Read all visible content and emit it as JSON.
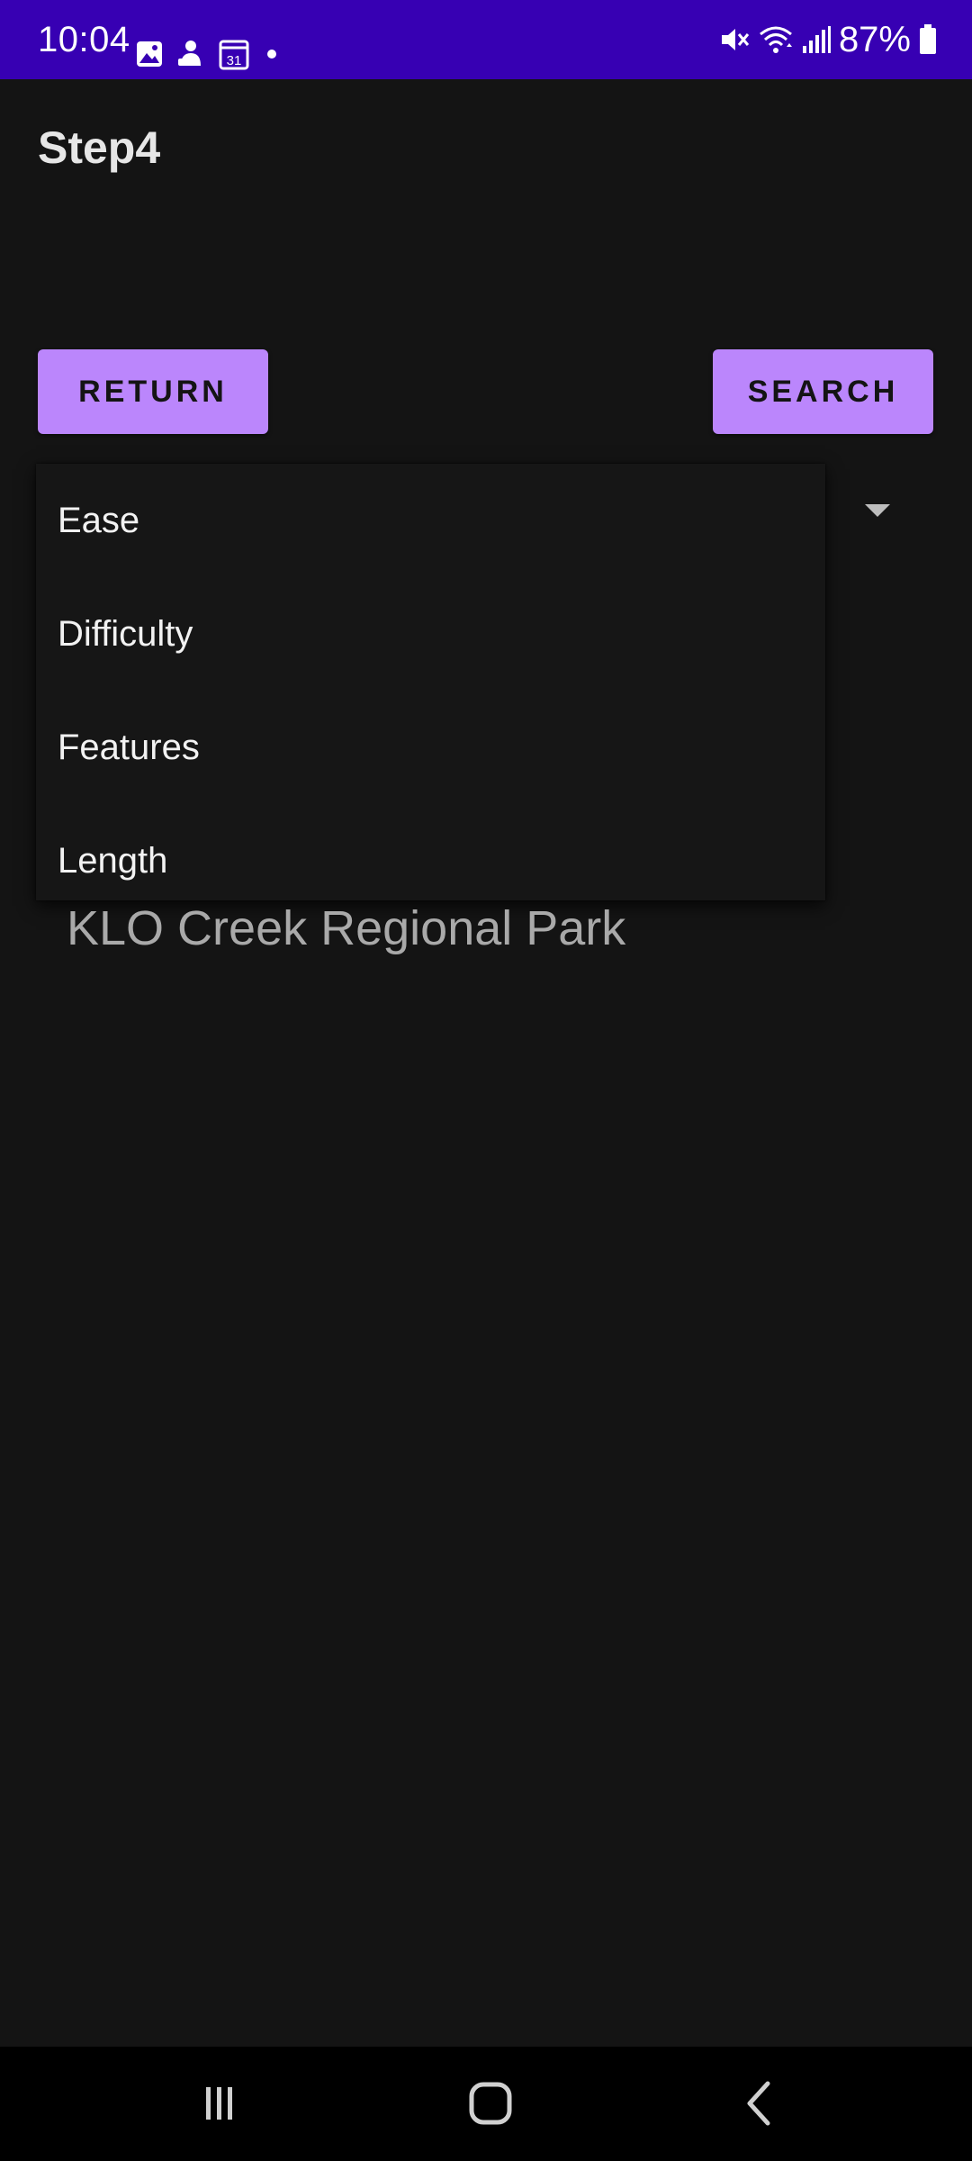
{
  "status_bar": {
    "time": "10:04",
    "battery_text": "87%",
    "left_icons": [
      "gallery-icon",
      "android-app-icon",
      "calendar-icon",
      "notification-dot-icon"
    ],
    "calendar_day": "31",
    "right_icons": [
      "mute-icon",
      "wifi-icon",
      "signal-icon",
      "battery-icon"
    ]
  },
  "header": {
    "title": "Step4"
  },
  "buttons": {
    "return_label": "RETURN",
    "search_label": "SEARCH"
  },
  "dropdown": {
    "options": [
      "Ease",
      "Difficulty",
      "Features",
      "Length"
    ]
  },
  "content": {
    "park_name": "KLO Creek Regional Park"
  },
  "navigation": {
    "buttons": [
      "recents-icon",
      "home-icon",
      "back-icon"
    ]
  },
  "colors": {
    "status_bar": "#3700b3",
    "background": "#141414",
    "button": "#bb86fc",
    "button_text": "#141414",
    "popup": "#161616",
    "park_text": "#a9a9a9"
  }
}
